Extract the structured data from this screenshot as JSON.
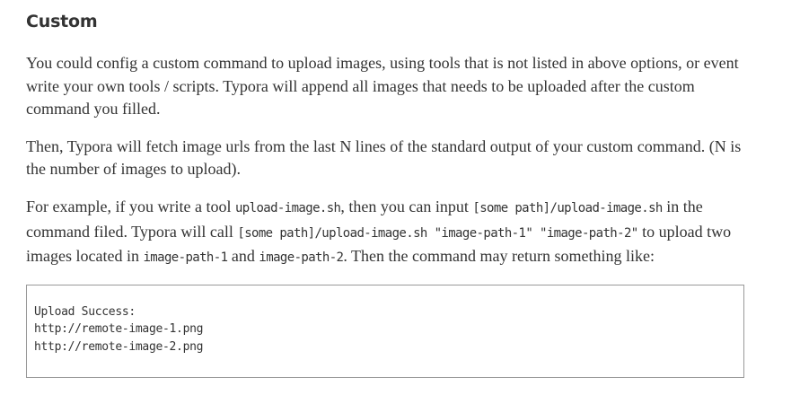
{
  "heading": "Custom",
  "para1": "You could config a custom command to upload images, using tools that is not listed in above options, or event write your own tools / scripts. Typora will append all images that needs to be uploaded after the custom command you filled.",
  "para2": "Then, Typora will fetch image urls from the last N lines of the standard output of your custom command. (N is the number of images to upload).",
  "para3": {
    "t1": "For example, if you write a tool ",
    "c1": "upload-image.sh",
    "t2": ", then you can input ",
    "c2": "[some path]/upload-image.sh",
    "t3": " in the command filed. Typora will call ",
    "c3": "[some path]/upload-image.sh \"image-path-1\" \"image-path-2\"",
    "t4": " to upload two images located in ",
    "c4": "image-path-1",
    "t5": " and ",
    "c5": "image-path-2",
    "t6": ". Then the command may return something like:"
  },
  "code_block": {
    "lines": [
      "Upload Success:",
      "http://remote-image-1.png",
      "http://remote-image-2.png"
    ]
  }
}
